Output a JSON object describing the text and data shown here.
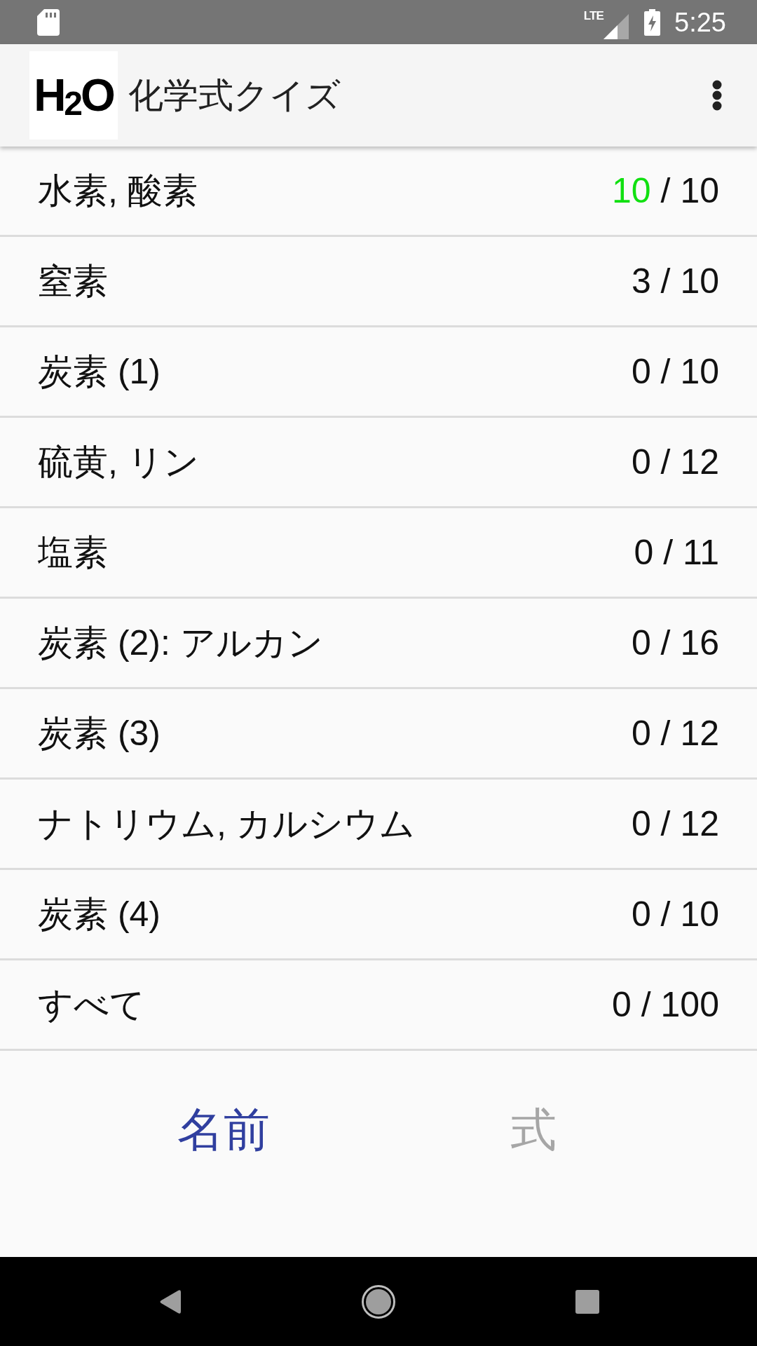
{
  "status_bar": {
    "network": "LTE",
    "time": "5:25"
  },
  "app_bar": {
    "logo": "H$_{2}$O",
    "title": "化学式クイズ"
  },
  "rows": [
    {
      "name": "水素, 酸素",
      "correct": "10",
      "total": "/ 10",
      "completed": true
    },
    {
      "name": "窒素",
      "correct": "3",
      "total": "/ 10",
      "completed": false
    },
    {
      "name": "炭素 (1)",
      "correct": "0",
      "total": "/ 10",
      "completed": false
    },
    {
      "name": "硫黄, リン",
      "correct": "0",
      "total": "/ 12",
      "completed": false
    },
    {
      "name": "塩素",
      "correct": "0",
      "total": "/ 11",
      "completed": false
    },
    {
      "name": "炭素 (2): アルカン",
      "correct": "0",
      "total": "/ 16",
      "completed": false
    },
    {
      "name": "炭素 (3)",
      "correct": "0",
      "total": "/ 12",
      "completed": false
    },
    {
      "name": "ナトリウム, カルシウム",
      "correct": "0",
      "total": "/ 12",
      "completed": false
    },
    {
      "name": "炭素 (4)",
      "correct": "0",
      "total": "/ 10",
      "completed": false
    },
    {
      "name": "すべて",
      "correct": "0",
      "total": "/ 100",
      "completed": false
    }
  ],
  "tabs": [
    {
      "label": "名前",
      "selected": true
    },
    {
      "label": "式",
      "selected": false
    }
  ]
}
